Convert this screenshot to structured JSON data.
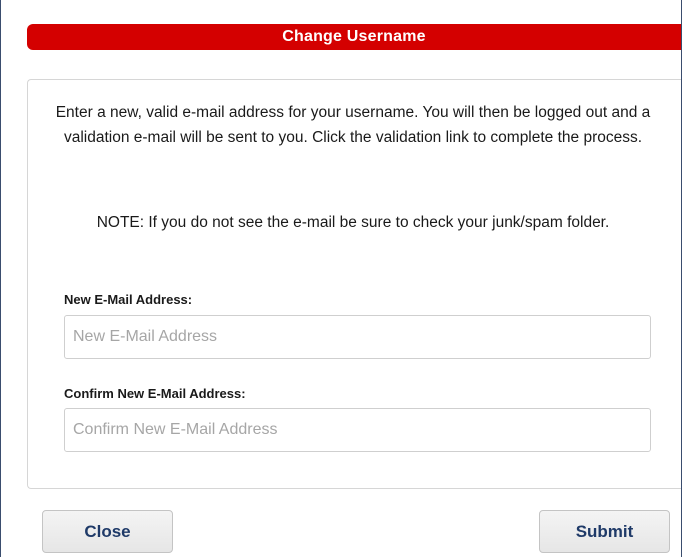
{
  "dialog": {
    "title": "Change Username",
    "message": "Enter a new, valid e-mail address for your username. You will then be logged out and a validation e-mail will be sent to you. Click the validation link to complete the process.",
    "note": "NOTE: If you do not see the e-mail be sure to check your junk/spam folder.",
    "fields": [
      {
        "label": "New E-Mail Address:",
        "value": "",
        "placeholder": "New E-Mail Address"
      },
      {
        "label": "Confirm New E-Mail Address:",
        "value": "",
        "placeholder": "Confirm New E-Mail Address"
      }
    ],
    "buttons": {
      "close_label": "Close",
      "submit_label": "Submit"
    }
  },
  "colors": {
    "title_bar": "#d40000",
    "button_text": "#1f3a68",
    "dialog_border": "#3a4d6e"
  }
}
